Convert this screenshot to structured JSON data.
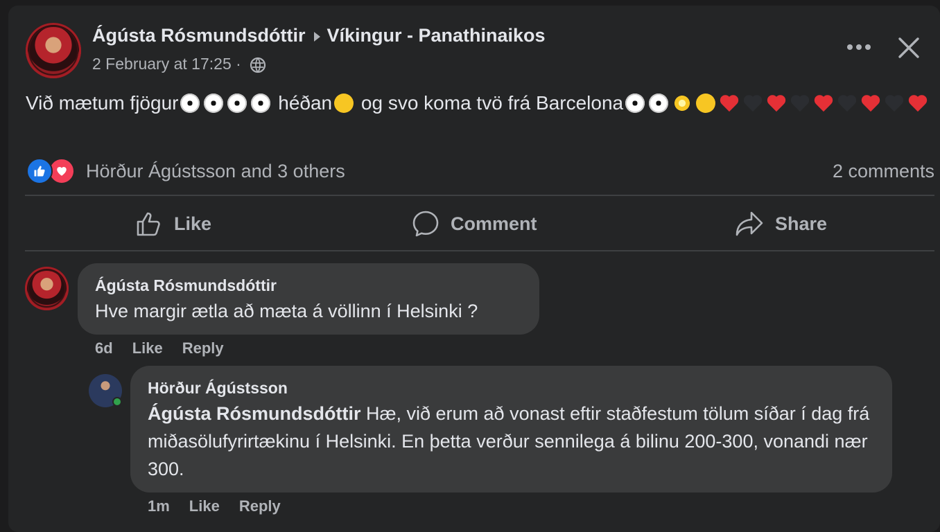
{
  "post": {
    "author": "Ágústa Rósmundsdóttir",
    "group": "Víkingur - Panathinaikos",
    "timestamp": "2 February at 17:25",
    "separator": "·",
    "text_parts": [
      "Við mætum fjögur",
      "héðan",
      "og svo koma tvö frá Barcelona"
    ],
    "reactions_text": "Hörður Ágústsson and 3 others",
    "comments_count": "2 comments"
  },
  "actions": {
    "like": "Like",
    "comment": "Comment",
    "share": "Share"
  },
  "comments": [
    {
      "author": "Ágústa Rósmundsdóttir",
      "text": "Hve margir ætla að mæta á völlinn í Helsinki ?",
      "time": "6d",
      "like": "Like",
      "reply": "Reply"
    },
    {
      "author": "Hörður Ágústsson",
      "mention": "Ágústa Rósmundsdóttir",
      "text": " Hæ, við erum að vonast eftir staðfestum tölum síðar í dag frá miðasölufyrirtækinu í Helsinki. En þetta verður sennilega á bilinu 200-300, vonandi nær 300.",
      "time": "1m",
      "like": "Like",
      "reply": "Reply"
    }
  ],
  "colors": {
    "like_blue": "#1b74e4",
    "love_red": "#f33e58",
    "online_green": "#31a24c",
    "card_bg": "#242526",
    "bubble_bg": "#3a3b3c"
  },
  "icons": [
    "globe-icon",
    "more-options-icon",
    "close-icon",
    "like-reaction-icon",
    "love-reaction-icon",
    "thumbs-up-icon",
    "comment-bubble-icon",
    "share-arrow-icon"
  ]
}
